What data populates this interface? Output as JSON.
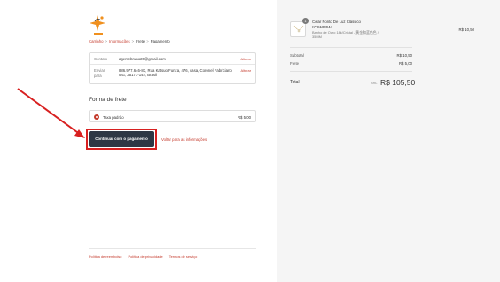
{
  "breadcrumb": {
    "items": [
      "Carrinho",
      "Informações",
      "Frete",
      "Pagamento"
    ],
    "separator": ">"
  },
  "info": {
    "contact_label": "Contato",
    "contact_value": "agentebruno20@gmail.com",
    "contact_change": "Alterar",
    "ship_to_label": "Enviar para",
    "ship_to_value": "886.977.646-83, Rua Katsuo Funza, 476, casa, Coronel Fabriciano MG, 35171-144, Brasil",
    "ship_to_change": "Alterar"
  },
  "shipping": {
    "section_title": "Forma de frete",
    "method_name": "Taxa padrão",
    "method_price": "R$ 5,00",
    "selected": true
  },
  "actions": {
    "continue_label": "Continuar com o pagamento",
    "back_label": "Voltar para as informações"
  },
  "footer": {
    "links": [
      "Política de reembolso",
      "Política de privacidade",
      "Termos de serviço"
    ]
  },
  "order": {
    "product": {
      "name": "Colar Ponto De Luz Clássico",
      "sku": "XYS100944",
      "variant": "Banho de Ouro 18k/Cristal - 黄金和蓝色色 / 35MM",
      "quantity": "1",
      "price": "R$ 10,50"
    },
    "subtotal_label": "Subtotal",
    "subtotal_value": "R$ 10,50",
    "shipping_label": "Frete",
    "shipping_value": "R$ 5,00",
    "total_label": "Total",
    "total_currency": "BRL",
    "total_value": "R$ 105,50"
  },
  "colors": {
    "accent": "#c4392b",
    "button_bg": "#2e3744",
    "highlight": "#d82020",
    "logo_orange": "#f0901e"
  },
  "icons": {
    "logo": "star-sparkle-logo",
    "product": "necklace-thumbnail",
    "annotation": "red-arrow"
  }
}
